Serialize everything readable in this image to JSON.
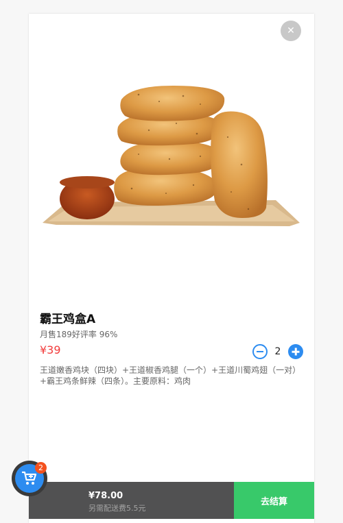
{
  "product": {
    "name": "霸王鸡盒A",
    "stats": "月售189好评率 96%",
    "price": "¥39",
    "quantity": "2",
    "description": "王道嫩香鸡块（四块）+王道椒香鸡腿（一个）+王道川蜀鸡翅（一对）+霸王鸡条鲜辣（四条）。主要原料：鸡肉"
  },
  "cart": {
    "badge_count": "2",
    "total": "¥78.00",
    "delivery_note": "另需配送费5.5元",
    "checkout_label": "去结算"
  },
  "icons": {
    "close": "close-icon",
    "minus": "minus-icon",
    "plus": "plus-icon",
    "cart": "cart-icon"
  },
  "colors": {
    "price": "#f23c3c",
    "accent": "#2d8cf0",
    "checkout": "#38c96a",
    "cart_bar": "#515152",
    "badge": "#f4511e"
  }
}
